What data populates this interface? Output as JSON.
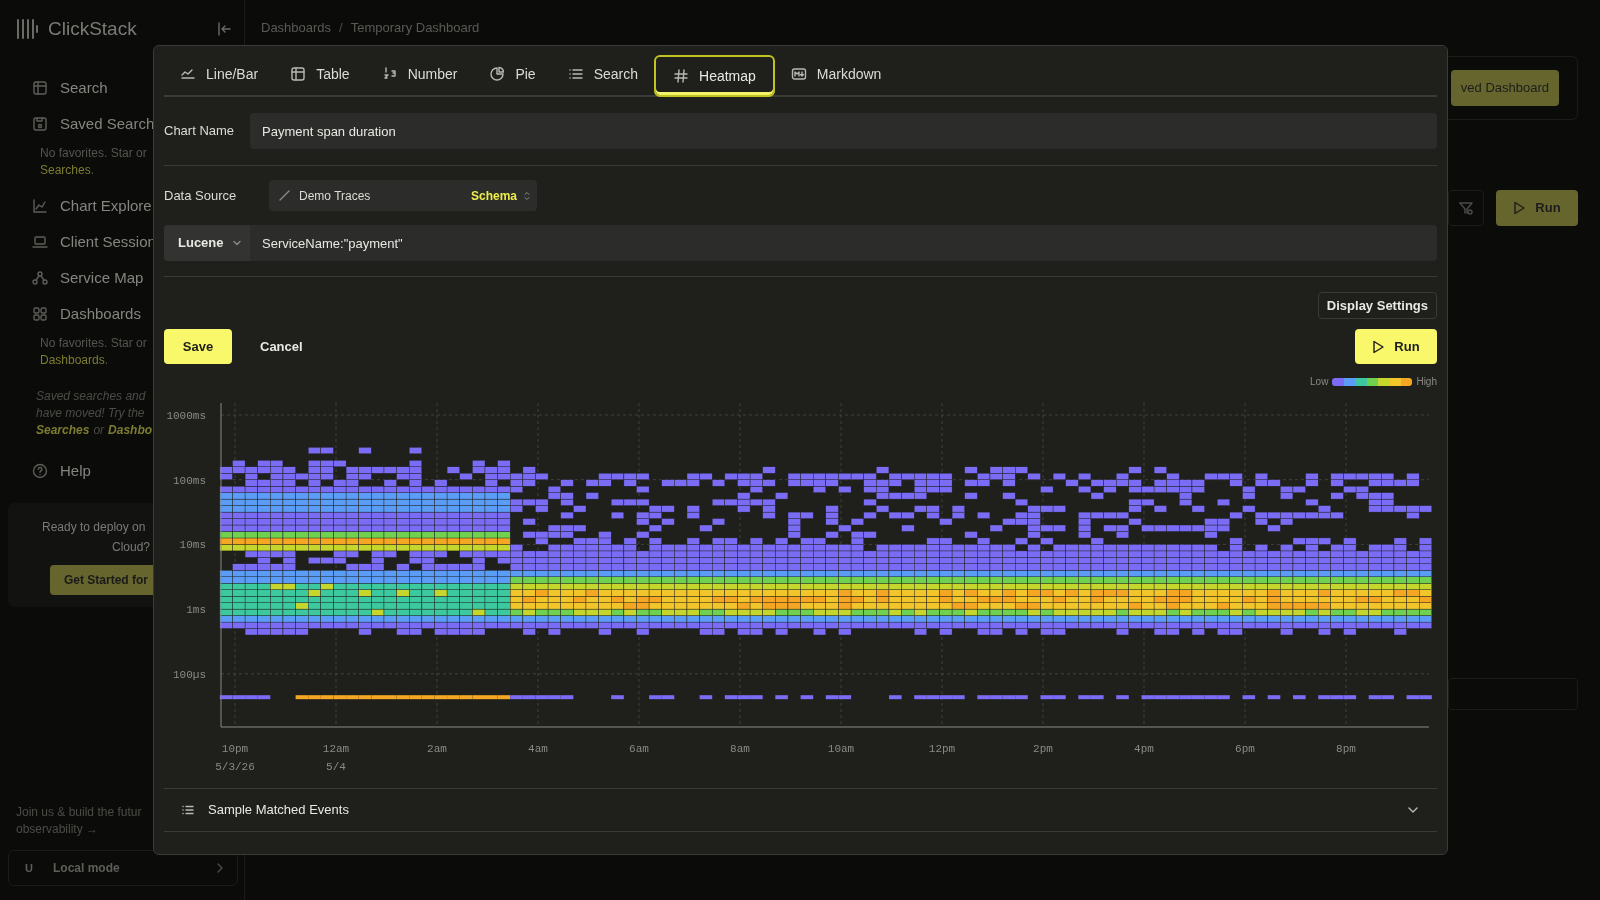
{
  "sidebar": {
    "brand": "ClickStack",
    "nav": [
      {
        "label": "Search"
      },
      {
        "label": "Saved Search",
        "note": {
          "text": "No favorites. Star or",
          "link": "Searches",
          "after": "."
        }
      },
      {
        "label": "Chart Explore"
      },
      {
        "label": "Client Session"
      },
      {
        "label": "Service Map"
      },
      {
        "label": "Dashboards",
        "note": {
          "text": "No favorites. Star or",
          "link": "Dashboards",
          "after": "."
        }
      }
    ],
    "migration_note": {
      "lines": [
        "Saved searches and",
        "have moved! Try the"
      ],
      "link_1": "Searches",
      "joiner": "or",
      "link_2": "Dashbo"
    },
    "help": "Help",
    "deploy_card": {
      "lines": [
        "Ready to deploy on",
        "Cloud?"
      ],
      "button": "Get Started for"
    },
    "join": [
      "Join us & build the futur",
      "observability →"
    ],
    "user": {
      "initial": "U",
      "label": "Local mode"
    }
  },
  "header": {
    "breadcrumbs": [
      "Dashboards",
      "Temporary Dashboard"
    ],
    "separator": "/"
  },
  "background": {
    "dashboard_button": "ved Dashboard",
    "run_button": "Run"
  },
  "dialog": {
    "tabs": [
      {
        "label": "Line/Bar",
        "selected": false
      },
      {
        "label": "Table",
        "selected": false
      },
      {
        "label": "Number",
        "selected": false
      },
      {
        "label": "Pie",
        "selected": false
      },
      {
        "label": "Search",
        "selected": false
      },
      {
        "label": "Heatmap",
        "selected": true
      },
      {
        "label": "Markdown",
        "selected": false
      }
    ],
    "chart_name": {
      "label": "Chart Name",
      "value": "Payment span duration"
    },
    "data_source": {
      "label": "Data Source",
      "value": "Demo Traces",
      "badge": "Schema"
    },
    "query": {
      "language": "Lucene",
      "value": "ServiceName:\"payment\""
    },
    "display_settings": "Display Settings",
    "save": "Save",
    "cancel": "Cancel",
    "run": "Run",
    "legend": {
      "low": "Low",
      "high": "High"
    },
    "heatmap": {
      "y_ticks": [
        "1000ms",
        "100ms",
        "10ms",
        "1ms",
        "100µs"
      ],
      "x_ticks": [
        {
          "label": "10pm",
          "sublabel": "5/3/26"
        },
        {
          "label": "12am",
          "sublabel": "5/4"
        },
        {
          "label": "2am"
        },
        {
          "label": "4am"
        },
        {
          "label": "6am"
        },
        {
          "label": "8am"
        },
        {
          "label": "10am"
        },
        {
          "label": "12pm"
        },
        {
          "label": "2pm"
        },
        {
          "label": "4pm"
        },
        {
          "label": "6pm"
        },
        {
          "label": "8pm"
        }
      ]
    },
    "sections": [
      {
        "label": "Sample Matched Events",
        "expanded": false
      }
    ]
  }
}
